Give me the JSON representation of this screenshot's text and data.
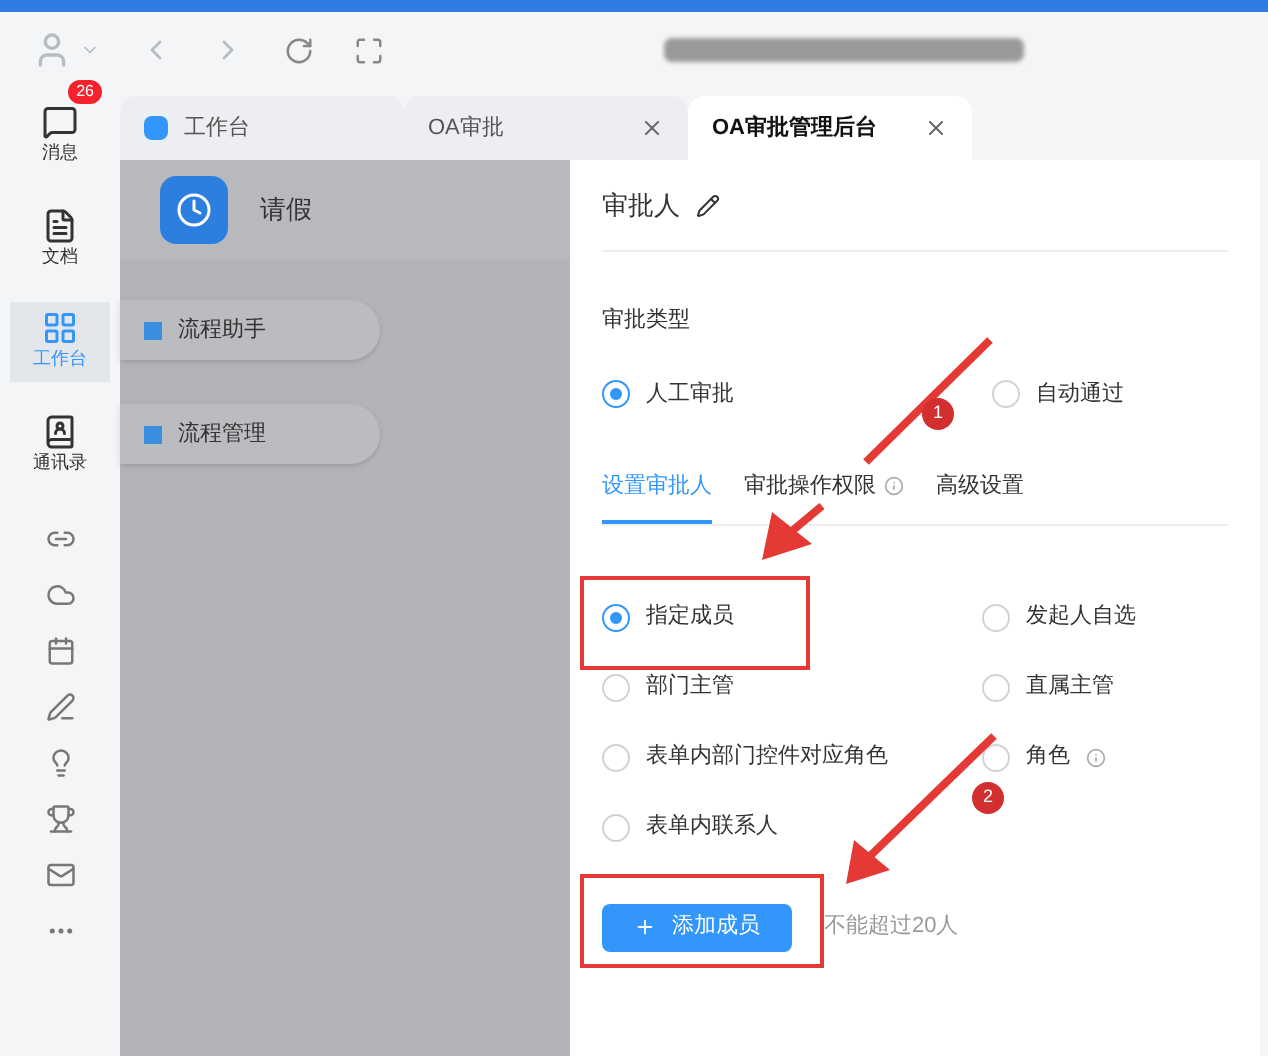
{
  "nav": {
    "items": [
      {
        "label": "消息",
        "badge": "26",
        "selected": false
      },
      {
        "label": "文档",
        "selected": false
      },
      {
        "label": "工作台",
        "selected": true
      },
      {
        "label": "通讯录",
        "selected": false
      }
    ]
  },
  "tabs": [
    {
      "label": "工作台",
      "selected": false,
      "closable": false
    },
    {
      "label": "OA审批",
      "selected": false,
      "closable": true
    },
    {
      "label": "OA审批管理后台",
      "selected": true,
      "closable": true
    }
  ],
  "app": {
    "title": "请假",
    "menu": [
      {
        "label": "流程助手"
      },
      {
        "label": "流程管理"
      }
    ]
  },
  "panel": {
    "title": "审批人",
    "type_label": "审批类型",
    "types": [
      {
        "label": "人工审批",
        "selected": true
      },
      {
        "label": "自动通过",
        "selected": false
      }
    ],
    "subtabs": [
      {
        "label": "设置审批人",
        "selected": true,
        "info": false
      },
      {
        "label": "审批操作权限",
        "selected": false,
        "info": true
      },
      {
        "label": "高级设置",
        "selected": false,
        "info": false
      }
    ],
    "options": [
      {
        "label": "指定成员",
        "selected": true,
        "info": false
      },
      {
        "label": "发起人自选",
        "selected": false,
        "info": false
      },
      {
        "label": "部门主管",
        "selected": false,
        "info": false
      },
      {
        "label": "直属主管",
        "selected": false,
        "info": false
      },
      {
        "label": "表单内部门控件对应角色",
        "selected": false,
        "info": false
      },
      {
        "label": "角色",
        "selected": false,
        "info": true
      },
      {
        "label": "表单内联系人",
        "selected": false,
        "info": false
      }
    ],
    "add_button": "添加成员",
    "add_hint": "不能超过20人"
  },
  "annotations": [
    {
      "label": "1"
    },
    {
      "label": "2"
    }
  ]
}
